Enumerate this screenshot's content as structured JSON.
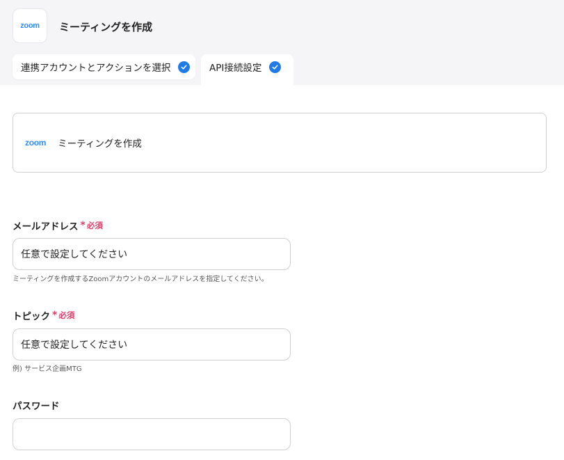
{
  "header": {
    "app_logo": "zoom",
    "title": "ミーティングを作成",
    "tabs": [
      {
        "label": "連携アカウントとアクションを選択",
        "completed": true
      },
      {
        "label": "API接続設定",
        "completed": true,
        "active": true
      }
    ]
  },
  "action_card": {
    "logo": "zoom",
    "label": "ミーティングを作成"
  },
  "fields": [
    {
      "label": "メールアドレス",
      "required": true,
      "required_star": "*",
      "required_text": "必須",
      "placeholder": "任意で設定してください",
      "value": "",
      "help": "ミーティングを作成するZoomアカウントのメールアドレスを指定してください。"
    },
    {
      "label": "トピック",
      "required": true,
      "required_star": "*",
      "required_text": "必須",
      "placeholder": "任意で設定してください",
      "value": "",
      "help": "例) サービス企画MTG"
    },
    {
      "label": "パスワード",
      "required": false,
      "placeholder": "",
      "value": ""
    }
  ],
  "colors": {
    "accent": "#1f7be8",
    "zoom_brand": "#2d8cff",
    "required": "#e03e6b",
    "header_bg": "#f5f5f7"
  }
}
